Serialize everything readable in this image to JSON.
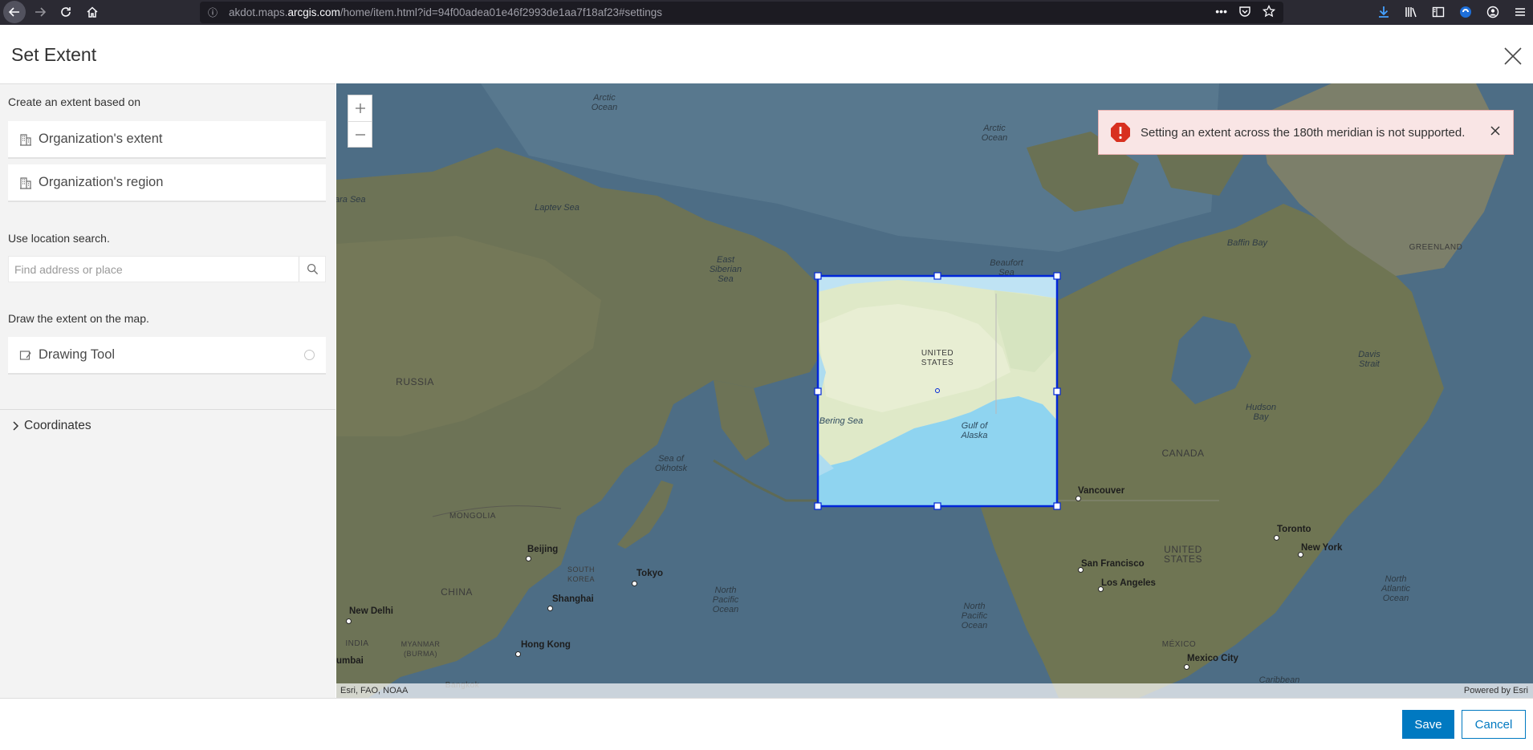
{
  "browser": {
    "url_prefix": "akdot.maps.",
    "url_domain": "arcgis.com",
    "url_path": "/home/item.html?id=94f00adea01e46f2993de1aa7f18af23#settings"
  },
  "dialog": {
    "title": "Set Extent"
  },
  "left_panel": {
    "extent_label": "Create an extent based on",
    "options": [
      {
        "label": "Organization's extent"
      },
      {
        "label": "Organization's region"
      }
    ],
    "location_label": "Use location search.",
    "search_placeholder": "Find address or place",
    "draw_label": "Draw the extent on the map.",
    "drawing_tool_label": "Drawing Tool",
    "coordinates_label": "Coordinates"
  },
  "map": {
    "alert_text": "Setting an extent across the 180th meridian is not supported.",
    "attribution": "Esri, FAO, NOAA",
    "powered_by": "Powered by Esri",
    "labels": {
      "arctic_ocean_1": "Arctic Ocean",
      "arctic_ocean_2": "Arctic Ocean",
      "kara_sea": "ara Sea",
      "laptev_sea": "Laptev Sea",
      "east_siberian_sea": "East Siberian Sea",
      "beaufort_sea": "Beaufort Sea",
      "baffin_bay": "Baffin Bay",
      "greenland": "GREENLAND",
      "davis_strait": "Davis Strait",
      "russia": "RUSSIA",
      "united_states_ak": "UNITED STATES",
      "bering_sea": "Bering Sea",
      "gulf_of_alaska": "Gulf of Alaska",
      "hudson_bay": "Hudson Bay",
      "canada": "CANADA",
      "sea_of_okhotsk": "Sea of Okhotsk",
      "mongolia": "MONGOLIA",
      "china": "CHINA",
      "south_korea": "SOUTH KOREA",
      "india": "INDIA",
      "myanmar": "MYANMAR (BURMA)",
      "north_pacific_1": "North Pacific Ocean",
      "north_pacific_2": "North Pacific Ocean",
      "united_states": "UNITED STATES",
      "mexico": "MÉXICO",
      "north_atlantic": "North Atlantic Ocean",
      "caribbean": "Caribbean",
      "bangkok": "Bangkok",
      "umbai": "umbai"
    },
    "cities": {
      "beijing": "Beijing",
      "tokyo": "Tokyo",
      "shanghai": "Shanghai",
      "hong_kong": "Hong Kong",
      "new_delhi": "New Delhi",
      "vancouver": "Vancouver",
      "san_francisco": "San Francisco",
      "los_angeles": "Los Angeles",
      "toronto": "Toronto",
      "new_york": "New York",
      "mexico_city": "Mexico City"
    }
  },
  "footer": {
    "save_label": "Save",
    "cancel_label": "Cancel"
  }
}
